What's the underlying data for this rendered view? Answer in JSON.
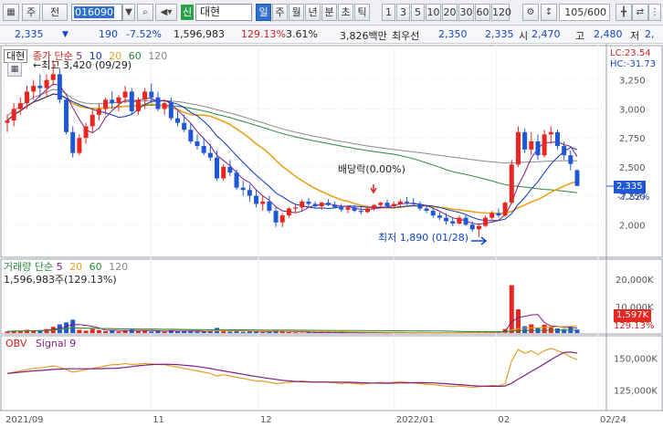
{
  "toolbar": {
    "mode_1": "주",
    "mode_2": "전",
    "code_value": "016090",
    "sin_label": "신",
    "stock_name": "대현",
    "period_tabs": [
      "일",
      "주",
      "월",
      "년",
      "분",
      "초",
      "틱"
    ],
    "active_period": "일",
    "minute_buttons": [
      "1",
      "3",
      "5",
      "10",
      "20",
      "30",
      "60",
      "120"
    ],
    "count_value": "105/600"
  },
  "quote": {
    "price": "2,335",
    "down_arrow": "▼",
    "change": "190",
    "change_pct": "-7.52%",
    "volume": "1,596,983",
    "volume_ratio": "129.13%",
    "turnover_pct": "3.61%",
    "amount": "3,826백만",
    "pref_label": "최우선",
    "pref_bid": "2,350",
    "pref_ask": "2,335",
    "open_label": "시",
    "open_value": "2,470",
    "high_label": "고",
    "high_value": "2,480",
    "low_label": "저",
    "low_value": "2,"
  },
  "legend": {
    "price_stock": "대현",
    "price_title": "종가 단순",
    "ma_labels": [
      "5",
      "10",
      "20",
      "60",
      "120"
    ],
    "volume_title": "거래량 단순",
    "volume_ma_labels": [
      "5",
      "20",
      "60",
      "120"
    ],
    "volume_value": "1,596,983주(129.13%)",
    "obv_title": "OBV",
    "obv_signal": "Signal 9"
  },
  "annotations": {
    "high": "←최고 3,420 (09/29)",
    "low": "최저 1,890 (01/28)",
    "dividend": "배당락(0.00%)",
    "lc": "LC:23.54",
    "hc": "HC:-31.73",
    "price_tag": "2,335",
    "pct_tag": "-7.52%",
    "vol_tag": "1,597K",
    "vol_pct_tag": "129.13%"
  },
  "colors": {
    "up": "#e8261f",
    "down": "#1f57d6",
    "ma5": "#7f1b7f",
    "ma10": "#0a35b8",
    "ma20": "#e9a21a",
    "ma60": "#2a8a3a",
    "ma120": "#8a8a8a"
  },
  "chart_data": {
    "type": "candlestick",
    "price_axis_ticks": [
      "3,250",
      "3,000",
      "2,750",
      "2,500",
      "2,250",
      "2,000"
    ],
    "volume_axis_ticks": [
      "20,000K",
      "10,000K"
    ],
    "obv_axis_ticks": [
      "150,000K",
      "125,000K"
    ],
    "x_axis_labels": [
      "2021/09",
      "11",
      "12",
      "2022/01",
      "02",
      "02/24"
    ],
    "candles": [
      [
        2880,
        2950,
        2800,
        2900
      ],
      [
        2900,
        3050,
        2850,
        3000
      ],
      [
        3000,
        3100,
        2950,
        3050
      ],
      [
        3050,
        3200,
        3000,
        3150
      ],
      [
        3150,
        3250,
        3080,
        3200
      ],
      [
        3200,
        3300,
        3100,
        3180
      ],
      [
        3180,
        3300,
        3100,
        3250
      ],
      [
        3250,
        3420,
        3200,
        3300
      ],
      [
        3300,
        3350,
        3050,
        3080
      ],
      [
        3080,
        3100,
        2780,
        2800
      ],
      [
        2800,
        2850,
        2580,
        2620
      ],
      [
        2620,
        2780,
        2600,
        2750
      ],
      [
        2750,
        2880,
        2700,
        2850
      ],
      [
        2850,
        3000,
        2800,
        2950
      ],
      [
        2950,
        3050,
        2900,
        3000
      ],
      [
        3000,
        3100,
        2950,
        3080
      ],
      [
        3080,
        3150,
        3000,
        3050
      ],
      [
        3050,
        3120,
        2980,
        3100
      ],
      [
        3100,
        3200,
        3050,
        3150
      ],
      [
        3150,
        3180,
        2950,
        2980
      ],
      [
        2980,
        3100,
        2950,
        3080
      ],
      [
        3080,
        3180,
        3000,
        3150
      ],
      [
        3150,
        3220,
        3050,
        3100
      ],
      [
        3100,
        3150,
        2980,
        3000
      ],
      [
        3000,
        3080,
        2950,
        3050
      ],
      [
        3050,
        3100,
        2900,
        2920
      ],
      [
        2920,
        2980,
        2850,
        2880
      ],
      [
        2880,
        2950,
        2800,
        2820
      ],
      [
        2820,
        2880,
        2700,
        2720
      ],
      [
        2720,
        2780,
        2650,
        2680
      ],
      [
        2680,
        2750,
        2600,
        2620
      ],
      [
        2620,
        2700,
        2550,
        2580
      ],
      [
        2580,
        2640,
        2380,
        2400
      ],
      [
        2400,
        2520,
        2380,
        2500
      ],
      [
        2500,
        2560,
        2420,
        2450
      ],
      [
        2450,
        2480,
        2300,
        2320
      ],
      [
        2320,
        2380,
        2250,
        2300
      ],
      [
        2300,
        2350,
        2200,
        2250
      ],
      [
        2250,
        2300,
        2150,
        2180
      ],
      [
        2180,
        2250,
        2120,
        2200
      ],
      [
        2200,
        2250,
        2100,
        2120
      ],
      [
        2120,
        2150,
        1980,
        2020
      ],
      [
        2020,
        2100,
        1980,
        2080
      ],
      [
        2080,
        2150,
        2060,
        2140
      ],
      [
        2140,
        2180,
        2100,
        2150
      ],
      [
        2150,
        2220,
        2120,
        2200
      ],
      [
        2200,
        2230,
        2150,
        2180
      ],
      [
        2180,
        2200,
        2140,
        2160
      ],
      [
        2160,
        2200,
        2130,
        2190
      ],
      [
        2190,
        2220,
        2160,
        2170
      ],
      [
        2170,
        2200,
        2140,
        2150
      ],
      [
        2150,
        2180,
        2110,
        2130
      ],
      [
        2130,
        2160,
        2100,
        2150
      ],
      [
        2150,
        2170,
        2110,
        2120
      ],
      [
        2120,
        2150,
        2090,
        2110
      ],
      [
        2110,
        2160,
        2100,
        2140
      ],
      [
        2140,
        2180,
        2120,
        2170
      ],
      [
        2170,
        2200,
        2140,
        2190
      ],
      [
        2190,
        2220,
        2150,
        2160
      ],
      [
        2160,
        2200,
        2140,
        2180
      ],
      [
        2180,
        2220,
        2150,
        2200
      ],
      [
        2200,
        2240,
        2170,
        2190
      ],
      [
        2190,
        2230,
        2160,
        2180
      ],
      [
        2180,
        2200,
        2120,
        2140
      ],
      [
        2140,
        2170,
        2100,
        2120
      ],
      [
        2120,
        2150,
        2060,
        2080
      ],
      [
        2080,
        2110,
        2040,
        2060
      ],
      [
        2060,
        2100,
        2000,
        2030
      ],
      [
        2030,
        2060,
        1990,
        2010
      ],
      [
        2010,
        2080,
        2000,
        2060
      ],
      [
        2060,
        2090,
        1990,
        2000
      ],
      [
        2000,
        2030,
        1940,
        1960
      ],
      [
        1960,
        2010,
        1890,
        1990
      ],
      [
        1990,
        2080,
        1980,
        2060
      ],
      [
        2060,
        2120,
        2040,
        2100
      ],
      [
        2100,
        2140,
        2060,
        2080
      ],
      [
        2080,
        2200,
        2070,
        2190
      ],
      [
        2190,
        2560,
        2180,
        2520
      ],
      [
        2520,
        2850,
        2500,
        2800
      ],
      [
        2800,
        2830,
        2620,
        2650
      ],
      [
        2650,
        2800,
        2600,
        2720
      ],
      [
        2720,
        2780,
        2560,
        2600
      ],
      [
        2600,
        2820,
        2580,
        2780
      ],
      [
        2780,
        2850,
        2700,
        2800
      ],
      [
        2800,
        2820,
        2650,
        2680
      ],
      [
        2680,
        2720,
        2560,
        2600
      ],
      [
        2600,
        2640,
        2470,
        2525
      ],
      [
        2470,
        2480,
        2335,
        2335
      ]
    ],
    "volumes": [
      900,
      1200,
      1000,
      1500,
      1300,
      1100,
      1800,
      2600,
      3500,
      4200,
      5200,
      1500,
      1200,
      1800,
      1400,
      1000,
      1300,
      900,
      1400,
      1600,
      1000,
      1200,
      900,
      1100,
      800,
      1300,
      900,
      1000,
      1200,
      800,
      900,
      1000,
      2200,
      1300,
      900,
      1200,
      800,
      900,
      1000,
      700,
      800,
      1400,
      900,
      700,
      600,
      500,
      600,
      500,
      700,
      500,
      400,
      600,
      500,
      500,
      400,
      500,
      600,
      500,
      400,
      500,
      600,
      500,
      400,
      600,
      500,
      500,
      400,
      600,
      500,
      700,
      600,
      800,
      700,
      900,
      600,
      700,
      1800,
      17800,
      9000,
      2800,
      3500,
      2200,
      3400,
      2500,
      2000,
      1800,
      2600,
      1597
    ],
    "obv": [
      138,
      139,
      140,
      141,
      142,
      142.5,
      143,
      144,
      143,
      141,
      139,
      140,
      141,
      142,
      143,
      144,
      145,
      145,
      146,
      145,
      145.5,
      146,
      145.5,
      145,
      145,
      144,
      143,
      142,
      141,
      140,
      139,
      138,
      136,
      137,
      136,
      135,
      134,
      133,
      132,
      132,
      131,
      130,
      130.5,
      131,
      131.5,
      132,
      131.5,
      131,
      131.5,
      131,
      130.5,
      130,
      130.5,
      130,
      129.5,
      130,
      130.5,
      131,
      130.5,
      131,
      131.5,
      131,
      130.5,
      130,
      129.5,
      129,
      128.5,
      128,
      127.5,
      128,
      127.5,
      127,
      127.5,
      128,
      128.5,
      128,
      130,
      148,
      157,
      154,
      156,
      153,
      156,
      158,
      156,
      154,
      151,
      149
    ]
  }
}
